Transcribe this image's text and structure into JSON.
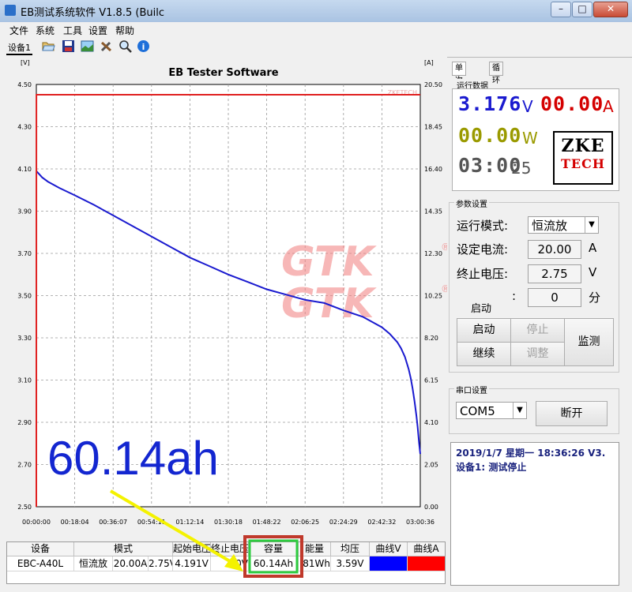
{
  "window": {
    "title": "EB测试系统软件 V1.8.5 (Builc",
    "min_label": "–",
    "max_label": "□",
    "close_label": "✕"
  },
  "menu": [
    "文件",
    "系统",
    "工具",
    "设置",
    "帮助"
  ],
  "toolbar": {
    "device_tab": "设备1",
    "icons": [
      "folder-open-icon",
      "save-icon",
      "chart-image-icon",
      "tools-icon",
      "search-icon",
      "info-icon"
    ]
  },
  "chart_data": {
    "type": "line",
    "title": "EB Tester Software",
    "watermark": "ZKETECH",
    "y_left": {
      "unit": "[V]",
      "ticks": [
        "4.50",
        "4.30",
        "4.10",
        "3.90",
        "3.70",
        "3.50",
        "3.30",
        "3.10",
        "2.90",
        "2.70",
        "2.50"
      ],
      "ylim": [
        2.5,
        4.5
      ]
    },
    "y_right": {
      "unit": "[A]",
      "ticks": [
        "20.50",
        "18.45",
        "16.40",
        "14.35",
        "12.30",
        "10.25",
        "8.20",
        "6.15",
        "4.10",
        "2.05",
        "0.00"
      ],
      "ylim": [
        0,
        20.5
      ]
    },
    "x_ticks": [
      "00:00:00",
      "00:18:04",
      "00:36:07",
      "00:54:11",
      "01:12:14",
      "01:30:18",
      "01:48:22",
      "02:06:25",
      "02:24:29",
      "02:42:32",
      "03:00:36"
    ],
    "series": [
      {
        "axis": "left",
        "color": "#1a1acf",
        "x": [
          0.0,
          0.5,
          1.5,
          3,
          6,
          10,
          15,
          20,
          25,
          30,
          35,
          40,
          45,
          50,
          55,
          60,
          65,
          70,
          75,
          80,
          85,
          90,
          92,
          94,
          95,
          96,
          96.5,
          97,
          97.5,
          98,
          98.5,
          99,
          99.3,
          99.5,
          99.7,
          100
        ],
        "y": [
          4.09,
          4.08,
          4.06,
          4.04,
          4.01,
          3.975,
          3.93,
          3.88,
          3.83,
          3.78,
          3.73,
          3.68,
          3.64,
          3.6,
          3.565,
          3.53,
          3.505,
          3.48,
          3.465,
          3.43,
          3.4,
          3.35,
          3.32,
          3.28,
          3.25,
          3.21,
          3.18,
          3.15,
          3.11,
          3.06,
          3.0,
          2.93,
          2.88,
          2.84,
          2.8,
          2.75
        ]
      },
      {
        "axis": "right",
        "color": "#e02020",
        "x": [
          0.0,
          0.02,
          100
        ],
        "y": [
          0.0,
          20.0,
          20.0
        ]
      }
    ]
  },
  "watermarks": [
    "GTK",
    "GTK",
    "®",
    "®"
  ],
  "overlay_label": "60.14ah",
  "right_panel": {
    "tabs": [
      "单次测试",
      "循环测试"
    ],
    "run_data_title": "运行数据",
    "voltage": "3.176",
    "voltage_unit": "V",
    "current": "00.00",
    "current_unit": "A",
    "power": "00.00",
    "power_unit": "W",
    "time": "03:00",
    "time_suffix": "25",
    "logo_line1": "ZKE",
    "logo_line2": "TECH",
    "params_title": "参数设置",
    "mode_label": "运行模式:",
    "mode_value": "恒流放",
    "current_set_label": "设定电流:",
    "current_set_value": "20.00",
    "current_set_unit": "A",
    "cutoff_label": "终止电压:",
    "cutoff_value": "2.75",
    "cutoff_unit": "V",
    "start_label": "启动",
    "colon": ":",
    "time_limit_value": "0",
    "time_limit_unit": "分",
    "btn_start": "启动",
    "btn_stop": "停止",
    "btn_continue": "继续",
    "btn_adjust": "调整",
    "btn_monitor": "监测",
    "serial_title": "串口设置",
    "port": "COM5",
    "btn_disconnect": "断开",
    "status_line1": "2019/1/7 星期一 18:36:26 V3.",
    "status_line2": "设备1: 测试停止"
  },
  "table": {
    "headers": [
      "设备",
      "模式",
      "起始电压",
      "终止电压",
      "容量",
      "能量",
      "均压",
      "曲线V",
      "曲线A"
    ],
    "row": [
      "EBC-A40L",
      "恒流放",
      "20.00A",
      "2.75V",
      "4.191V",
      "70V",
      "60.14Ah",
      "81Wh",
      "3.59V"
    ],
    "curve_v_color": "#0000ff",
    "curve_a_color": "#ff0000"
  }
}
